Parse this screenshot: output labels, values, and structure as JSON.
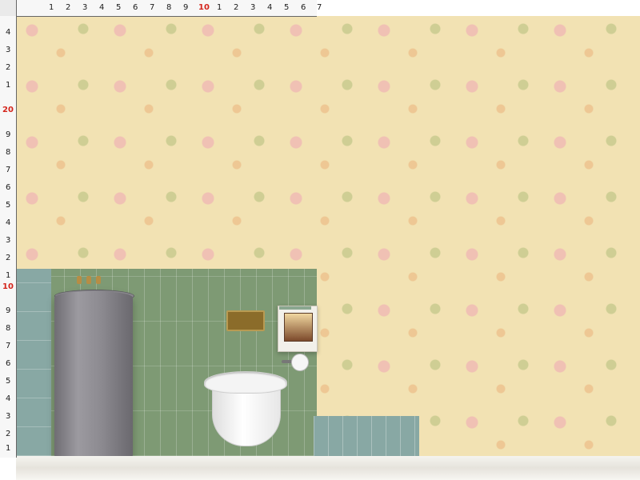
{
  "ruler_top": [
    "1",
    "2",
    "3",
    "4",
    "5",
    "6",
    "7",
    "8",
    "9",
    "10",
    "1",
    "2",
    "3",
    "4",
    "5",
    "6",
    "7"
  ],
  "ruler_left": [
    "4",
    "3",
    "2",
    "1",
    "20",
    "9",
    "8",
    "7",
    "6",
    "5",
    "4",
    "3",
    "2",
    "1",
    "10",
    "9",
    "8",
    "7",
    "6",
    "5",
    "4",
    "3",
    "2",
    "1"
  ],
  "palette": {
    "wallpaper": "#f2e2b3",
    "tiles_green": "#7e9a74",
    "tiles_blue": "#88a8a4",
    "brass": "#b68d45"
  }
}
